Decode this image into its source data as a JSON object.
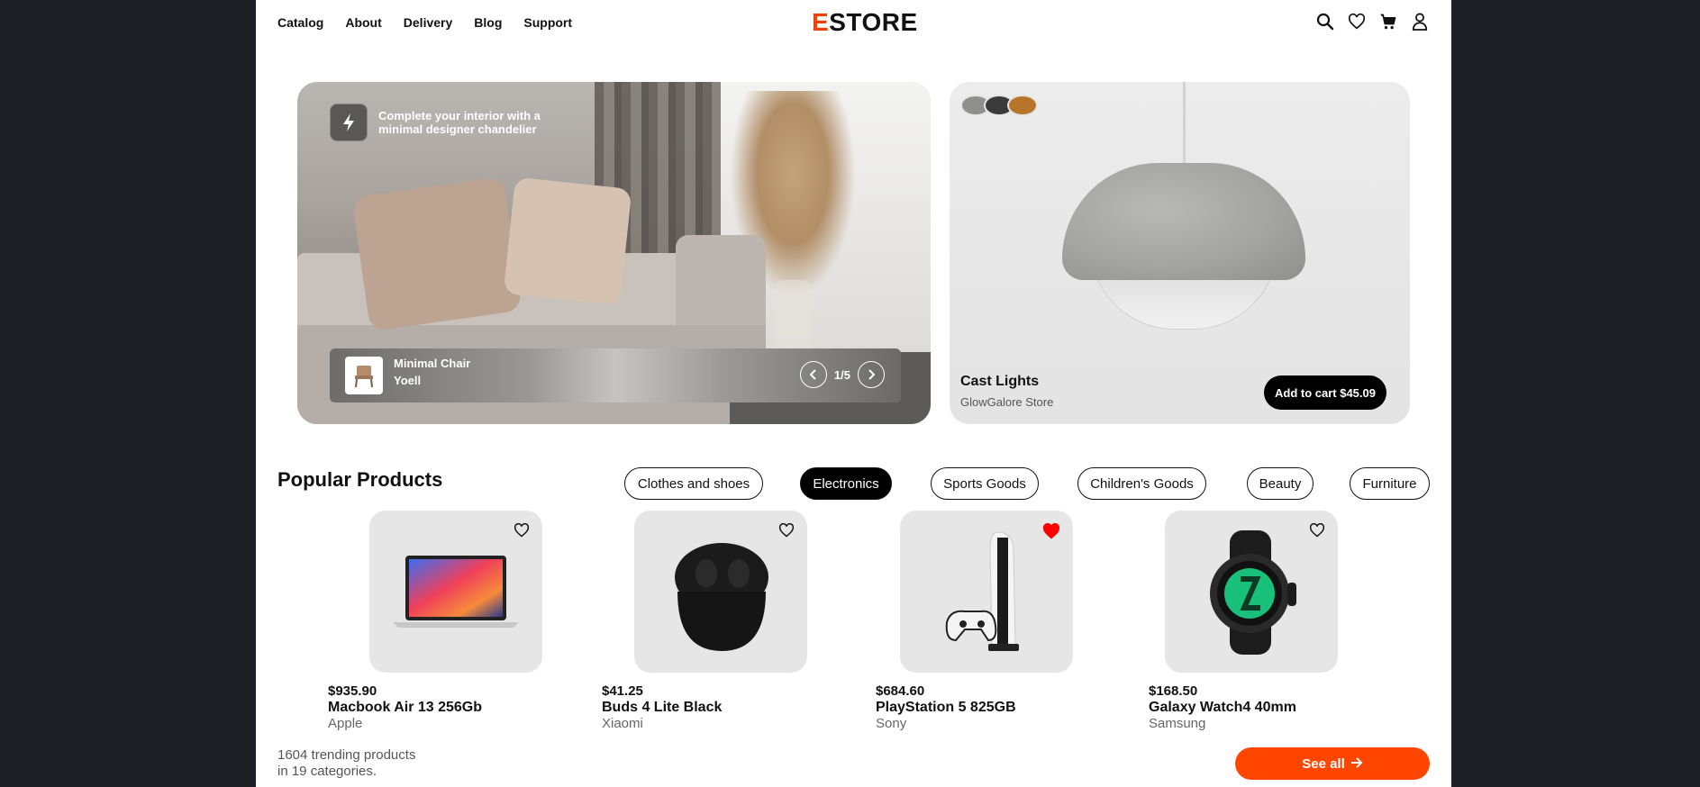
{
  "header": {
    "nav": [
      "Catalog",
      "About",
      "Delivery",
      "Blog",
      "Support"
    ],
    "logo_accent": "E",
    "logo_rest": "STORE",
    "icons": [
      "search-icon",
      "heart-icon",
      "cart-icon",
      "user-icon"
    ]
  },
  "hero": {
    "promo_text": "Complete your interior with a minimal designer chandelier",
    "product_name": "Minimal Chair",
    "product_brand": "Yoell",
    "slide_indicator": "1/5"
  },
  "feature": {
    "title": "Cast Lights",
    "store": "GlowGalore Store",
    "cart_button": "Add to cart $45.09",
    "swatches": [
      "#8f8f8e",
      "#3a3a3a",
      "#b7742b"
    ]
  },
  "popular": {
    "title": "Popular Products",
    "categories": [
      "Clothes and shoes",
      "Electronics",
      "Sports Goods",
      "Children's Goods",
      "Beauty",
      "Furniture"
    ],
    "active_category": "Electronics",
    "products": [
      {
        "price": "$935.90",
        "name": "Macbook Air 13 256Gb",
        "brand": "Apple",
        "favorite": false
      },
      {
        "price": "$41.25",
        "name": "Buds 4 Lite Black",
        "brand": "Xiaomi",
        "favorite": false
      },
      {
        "price": "$684.60",
        "name": "PlayStation 5 825GB",
        "brand": "Sony",
        "favorite": true
      },
      {
        "price": "$168.50",
        "name": "Galaxy Watch4 40mm",
        "brand": "Samsung",
        "favorite": false
      }
    ],
    "summary_line1": "1604 trending products",
    "summary_line2": "in 19 categories.",
    "see_all": "See all"
  },
  "colors": {
    "accent": "#ff4500",
    "favorite": "#ff0000",
    "page_bg": "#1e1f26"
  }
}
